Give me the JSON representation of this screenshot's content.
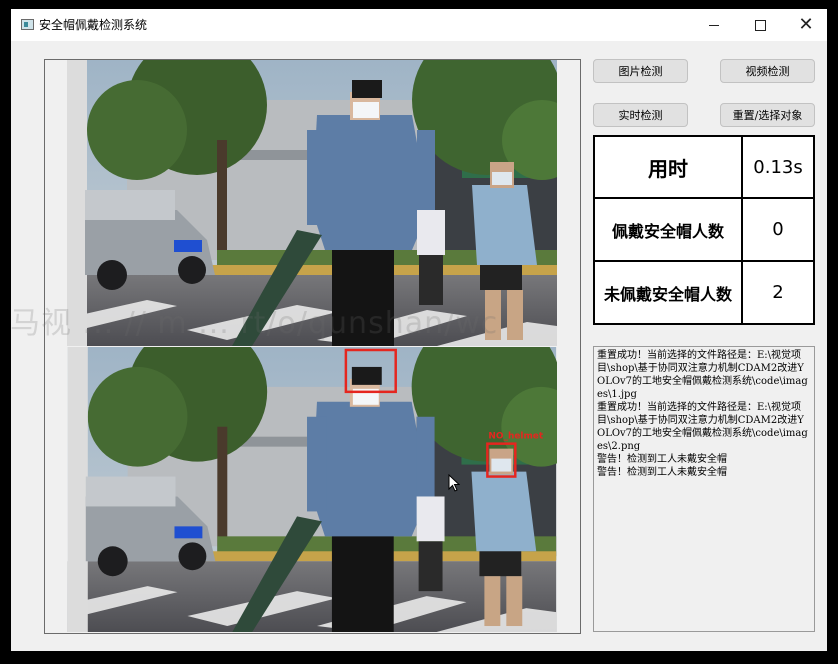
{
  "window": {
    "title": "安全帽佩戴检测系统"
  },
  "buttons": {
    "image_detect": "图片检测",
    "video_detect": "视频检测",
    "realtime_detect": "实时检测",
    "reset_select": "重置/选择对象"
  },
  "stats": {
    "time_label": "用时",
    "time_value": "0.13s",
    "helmet_label": "佩戴安全帽人数",
    "helmet_value": "0",
    "no_helmet_label": "未佩戴安全帽人数",
    "no_helmet_value": "2"
  },
  "detections": {
    "label": "NO_helmet"
  },
  "log": {
    "lines": [
      "重置成功！当前选择的文件路径是：E:\\视觉项目\\shop\\基于协同双注意力机制CDAM2改进YOLOv7的工地安全帽佩戴检测系统\\code\\images\\1.jpg",
      "重置成功！当前选择的文件路径是：E:\\视觉项目\\shop\\基于协同双注意力机制CDAM2改进YOLOv7的工地安全帽佩戴检测系统\\code\\images\\2.png",
      "警告！检测到工人未戴安全帽",
      "警告！检测到工人未戴安全帽"
    ]
  },
  "watermark": "马视 ... // m ... rt/o/qunshan/wc",
  "colors": {
    "detection_box": "#e5261f",
    "window_bg": "#f0f0f0"
  }
}
